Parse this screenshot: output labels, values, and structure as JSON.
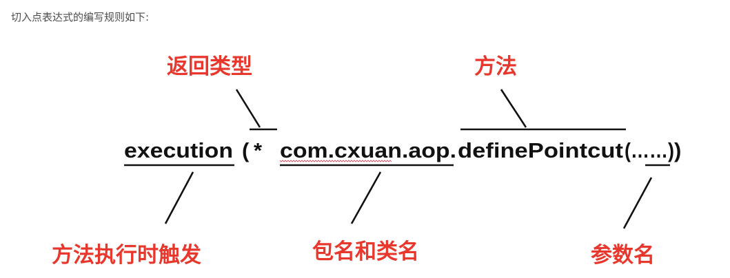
{
  "intro_text": "切入点表达式的编写规则如下:",
  "expression": {
    "execution": "execution",
    "open": "(",
    "star": "*",
    "package_class": "com.cxuan.aop.",
    "method": "definePointcut",
    "params": "(……)",
    "close_paren": ")"
  },
  "labels": {
    "return_type": "返回类型",
    "method": "方法",
    "trigger": "方法执行时触发",
    "package_class": "包名和类名",
    "param_name": "参数名"
  },
  "colors": {
    "label": "#e8372d",
    "expression": "#111111",
    "spellcheck_underline": "#e05a6a"
  }
}
